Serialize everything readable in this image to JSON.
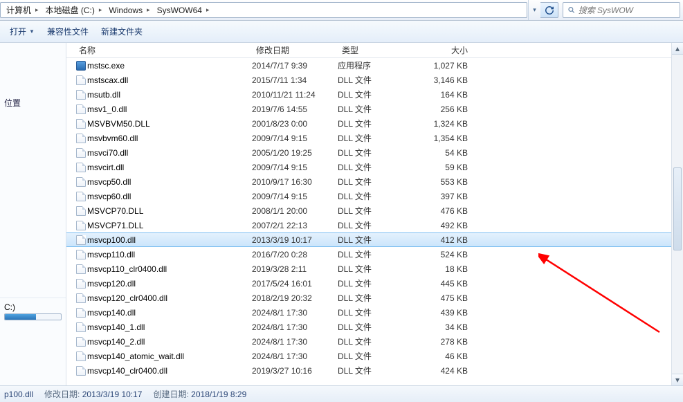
{
  "breadcrumbs": [
    "计算机",
    "本地磁盘 (C:)",
    "Windows",
    "SysWOW64"
  ],
  "search": {
    "placeholder": "搜索 SysWOW"
  },
  "toolbar": {
    "open": "打开",
    "compat": "兼容性文件",
    "newFolder": "新建文件夹"
  },
  "sidebar": {
    "loc": "位置",
    "drive": "C:)"
  },
  "columns": {
    "name": "名称",
    "date": "修改日期",
    "type": "类型",
    "size": "大小"
  },
  "selected_index": 12,
  "files": [
    {
      "name": "mstsc.exe",
      "date": "2014/7/17 9:39",
      "type": "应用程序",
      "size": "1,027 KB",
      "icon": "exe"
    },
    {
      "name": "mstscax.dll",
      "date": "2015/7/11 1:34",
      "type": "DLL 文件",
      "size": "3,146 KB",
      "icon": "dll"
    },
    {
      "name": "msutb.dll",
      "date": "2010/11/21 11:24",
      "type": "DLL 文件",
      "size": "164 KB",
      "icon": "dll"
    },
    {
      "name": "msv1_0.dll",
      "date": "2019/7/6 14:55",
      "type": "DLL 文件",
      "size": "256 KB",
      "icon": "dll"
    },
    {
      "name": "MSVBVM50.DLL",
      "date": "2001/8/23 0:00",
      "type": "DLL 文件",
      "size": "1,324 KB",
      "icon": "dll"
    },
    {
      "name": "msvbvm60.dll",
      "date": "2009/7/14 9:15",
      "type": "DLL 文件",
      "size": "1,354 KB",
      "icon": "dll"
    },
    {
      "name": "msvci70.dll",
      "date": "2005/1/20 19:25",
      "type": "DLL 文件",
      "size": "54 KB",
      "icon": "dll"
    },
    {
      "name": "msvcirt.dll",
      "date": "2009/7/14 9:15",
      "type": "DLL 文件",
      "size": "59 KB",
      "icon": "dll"
    },
    {
      "name": "msvcp50.dll",
      "date": "2010/9/17 16:30",
      "type": "DLL 文件",
      "size": "553 KB",
      "icon": "dll"
    },
    {
      "name": "msvcp60.dll",
      "date": "2009/7/14 9:15",
      "type": "DLL 文件",
      "size": "397 KB",
      "icon": "dll"
    },
    {
      "name": "MSVCP70.DLL",
      "date": "2008/1/1 20:00",
      "type": "DLL 文件",
      "size": "476 KB",
      "icon": "dll"
    },
    {
      "name": "MSVCP71.DLL",
      "date": "2007/2/1 22:13",
      "type": "DLL 文件",
      "size": "492 KB",
      "icon": "dll"
    },
    {
      "name": "msvcp100.dll",
      "date": "2013/3/19 10:17",
      "type": "DLL 文件",
      "size": "412 KB",
      "icon": "dll"
    },
    {
      "name": "msvcp110.dll",
      "date": "2016/7/20 0:28",
      "type": "DLL 文件",
      "size": "524 KB",
      "icon": "dll"
    },
    {
      "name": "msvcp110_clr0400.dll",
      "date": "2019/3/28 2:11",
      "type": "DLL 文件",
      "size": "18 KB",
      "icon": "dll"
    },
    {
      "name": "msvcp120.dll",
      "date": "2017/5/24 16:01",
      "type": "DLL 文件",
      "size": "445 KB",
      "icon": "dll"
    },
    {
      "name": "msvcp120_clr0400.dll",
      "date": "2018/2/19 20:32",
      "type": "DLL 文件",
      "size": "475 KB",
      "icon": "dll"
    },
    {
      "name": "msvcp140.dll",
      "date": "2024/8/1 17:30",
      "type": "DLL 文件",
      "size": "439 KB",
      "icon": "dll"
    },
    {
      "name": "msvcp140_1.dll",
      "date": "2024/8/1 17:30",
      "type": "DLL 文件",
      "size": "34 KB",
      "icon": "dll"
    },
    {
      "name": "msvcp140_2.dll",
      "date": "2024/8/1 17:30",
      "type": "DLL 文件",
      "size": "278 KB",
      "icon": "dll"
    },
    {
      "name": "msvcp140_atomic_wait.dll",
      "date": "2024/8/1 17:30",
      "type": "DLL 文件",
      "size": "46 KB",
      "icon": "dll"
    },
    {
      "name": "msvcp140_clr0400.dll",
      "date": "2019/3/27 10:16",
      "type": "DLL 文件",
      "size": "424 KB",
      "icon": "dll"
    }
  ],
  "status": {
    "filename": "p100.dll",
    "modLabel": "修改日期:",
    "modValue": "2013/3/19 10:17",
    "createdLabel": "创建日期:",
    "createdValue": "2018/1/19 8:29"
  }
}
